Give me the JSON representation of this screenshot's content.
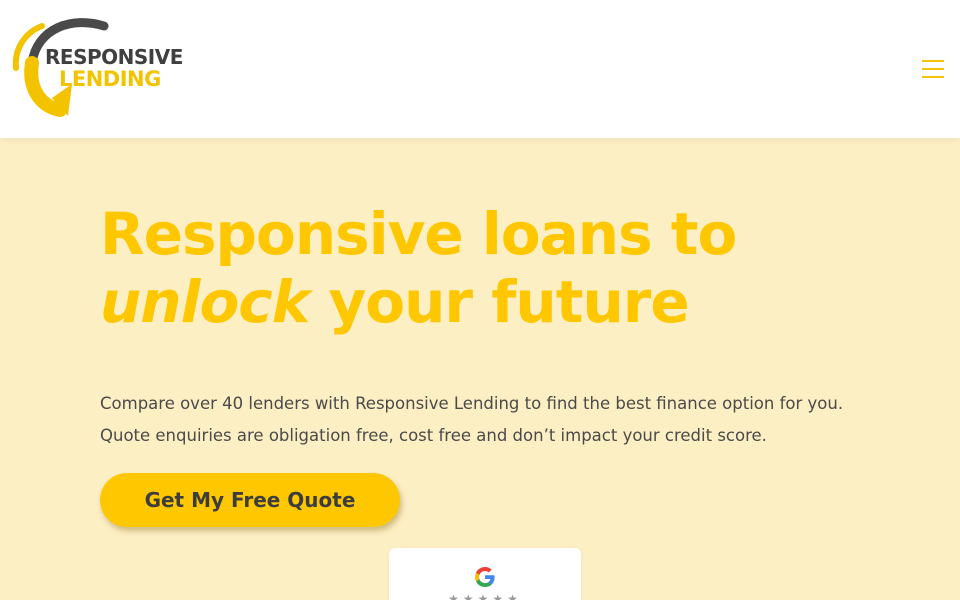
{
  "brand": {
    "name_line1": "RESPONSIVE",
    "name_line2": "LENDING",
    "primary_color": "#ffc700",
    "dark_color": "#3f3f3f"
  },
  "header": {
    "menu_icon": "hamburger-menu-icon"
  },
  "hero": {
    "title_part1": "Responsive loans to",
    "title_accent": "unlock",
    "title_part2": " your future",
    "description": "Compare over 40 lenders with Responsive Lending to find the best finance option for you. Quote enquiries are obligation free, cost free and don’t impact your credit score.",
    "cta_label": "Get My Free Quote",
    "background_color": "#fdefc4"
  },
  "reviews": {
    "icon": "google-icon",
    "stars": "★★★★★"
  }
}
